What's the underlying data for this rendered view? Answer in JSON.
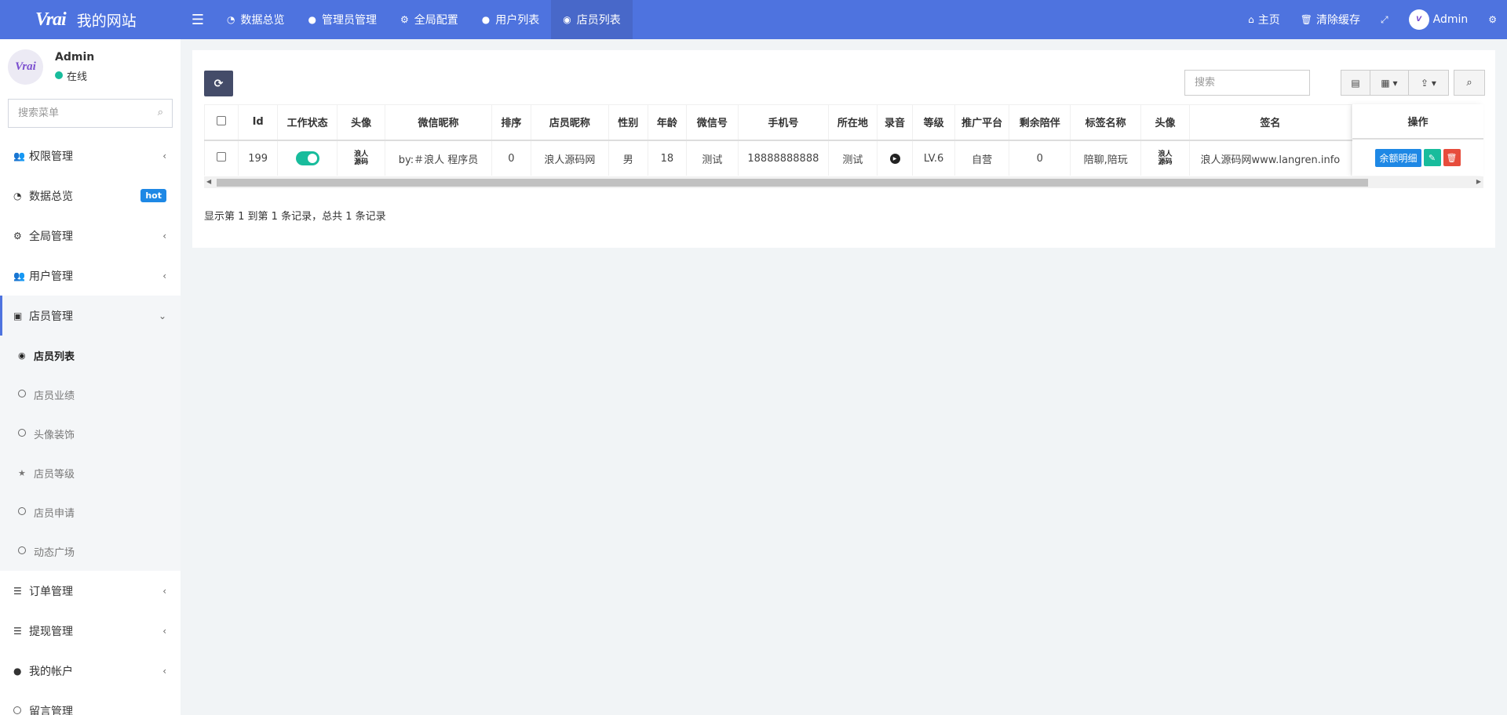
{
  "header": {
    "logo_text": "Vrai",
    "site_title": "我的网站",
    "menu_icon": "bars-icon",
    "tabs": [
      {
        "label": "数据总览",
        "icon": "dashboard-icon"
      },
      {
        "label": "管理员管理",
        "icon": "user-icon"
      },
      {
        "label": "全局配置",
        "icon": "gear-icon"
      },
      {
        "label": "用户列表",
        "icon": "user-icon"
      },
      {
        "label": "店员列表",
        "icon": "user-circle-icon"
      }
    ],
    "right": {
      "home_label": "主页",
      "clear_cache_label": "清除缓存",
      "fullscreen_icon": "expand-icon",
      "admin_label": "Admin",
      "settings_icon": "gears-icon"
    }
  },
  "sidebar": {
    "user": {
      "name": "Admin",
      "status": "在线",
      "avatar_text": "Vrai"
    },
    "search_placeholder": "搜索菜单",
    "items": [
      {
        "label": "权限管理",
        "icon": "users-icon",
        "arrow": "‹"
      },
      {
        "label": "数据总览",
        "icon": "dashboard-icon",
        "badge": "hot"
      },
      {
        "label": "全局管理",
        "icon": "gears-icon",
        "arrow": "‹"
      },
      {
        "label": "用户管理",
        "icon": "users-icon",
        "arrow": "‹"
      },
      {
        "label": "店员管理",
        "icon": "id-card-icon",
        "arrow": "⌄"
      }
    ],
    "subitems": [
      {
        "label": "店员列表"
      },
      {
        "label": "店员业绩"
      },
      {
        "label": "头像装饰"
      },
      {
        "label": "店员等级"
      },
      {
        "label": "店员申请"
      },
      {
        "label": "动态广场"
      }
    ],
    "items_after": [
      {
        "label": "订单管理",
        "icon": "database-icon",
        "arrow": "‹"
      },
      {
        "label": "提现管理",
        "icon": "database-icon",
        "arrow": "‹"
      },
      {
        "label": "我的帐户",
        "icon": "user-icon",
        "arrow": "‹"
      },
      {
        "label": "留言管理",
        "icon": "circle-icon"
      }
    ]
  },
  "toolbar": {
    "search_placeholder": "搜索"
  },
  "table": {
    "headers": [
      "Id",
      "工作状态",
      "头像",
      "微信昵称",
      "排序",
      "店员昵称",
      "性别",
      "年龄",
      "微信号",
      "手机号",
      "所在地",
      "录音",
      "等级",
      "推广平台",
      "剩余陪伴",
      "标签名称",
      "头像",
      "签名"
    ],
    "ops_header": "操作",
    "rows": [
      {
        "id": "199",
        "avatar_text": "浪人源码",
        "wechat_nick": "by:＃浪人 程序员",
        "sort": "0",
        "nick": "浪人源码网",
        "gender": "男",
        "age": "18",
        "wechat_id": "测试",
        "phone": "18888888888",
        "location": "测试",
        "level": "LV.6",
        "platform": "自营",
        "remaining": "0",
        "tags": "陪聊,陪玩",
        "avatar2_text": "浪人源码",
        "signature": "浪人源码网www.langren.info",
        "detail_button": "余额明细"
      }
    ]
  },
  "pager": {
    "info": "显示第 1 到第 1 条记录，总共 1 条记录"
  },
  "colors": {
    "primary": "#4e73df",
    "success": "#18bc9c",
    "info": "#1e88e5",
    "danger": "#e74c3c",
    "dark_button": "#444c69"
  }
}
